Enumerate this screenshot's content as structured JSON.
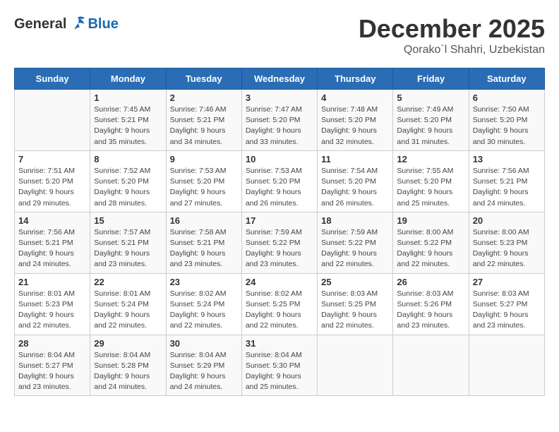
{
  "header": {
    "logo_general": "General",
    "logo_blue": "Blue",
    "month_title": "December 2025",
    "location": "Qorako`l Shahri, Uzbekistan"
  },
  "days_of_week": [
    "Sunday",
    "Monday",
    "Tuesday",
    "Wednesday",
    "Thursday",
    "Friday",
    "Saturday"
  ],
  "weeks": [
    [
      {
        "day": "",
        "info": ""
      },
      {
        "day": "1",
        "info": "Sunrise: 7:45 AM\nSunset: 5:21 PM\nDaylight: 9 hours\nand 35 minutes."
      },
      {
        "day": "2",
        "info": "Sunrise: 7:46 AM\nSunset: 5:21 PM\nDaylight: 9 hours\nand 34 minutes."
      },
      {
        "day": "3",
        "info": "Sunrise: 7:47 AM\nSunset: 5:20 PM\nDaylight: 9 hours\nand 33 minutes."
      },
      {
        "day": "4",
        "info": "Sunrise: 7:48 AM\nSunset: 5:20 PM\nDaylight: 9 hours\nand 32 minutes."
      },
      {
        "day": "5",
        "info": "Sunrise: 7:49 AM\nSunset: 5:20 PM\nDaylight: 9 hours\nand 31 minutes."
      },
      {
        "day": "6",
        "info": "Sunrise: 7:50 AM\nSunset: 5:20 PM\nDaylight: 9 hours\nand 30 minutes."
      }
    ],
    [
      {
        "day": "7",
        "info": "Sunrise: 7:51 AM\nSunset: 5:20 PM\nDaylight: 9 hours\nand 29 minutes."
      },
      {
        "day": "8",
        "info": "Sunrise: 7:52 AM\nSunset: 5:20 PM\nDaylight: 9 hours\nand 28 minutes."
      },
      {
        "day": "9",
        "info": "Sunrise: 7:53 AM\nSunset: 5:20 PM\nDaylight: 9 hours\nand 27 minutes."
      },
      {
        "day": "10",
        "info": "Sunrise: 7:53 AM\nSunset: 5:20 PM\nDaylight: 9 hours\nand 26 minutes."
      },
      {
        "day": "11",
        "info": "Sunrise: 7:54 AM\nSunset: 5:20 PM\nDaylight: 9 hours\nand 26 minutes."
      },
      {
        "day": "12",
        "info": "Sunrise: 7:55 AM\nSunset: 5:20 PM\nDaylight: 9 hours\nand 25 minutes."
      },
      {
        "day": "13",
        "info": "Sunrise: 7:56 AM\nSunset: 5:21 PM\nDaylight: 9 hours\nand 24 minutes."
      }
    ],
    [
      {
        "day": "14",
        "info": "Sunrise: 7:56 AM\nSunset: 5:21 PM\nDaylight: 9 hours\nand 24 minutes."
      },
      {
        "day": "15",
        "info": "Sunrise: 7:57 AM\nSunset: 5:21 PM\nDaylight: 9 hours\nand 23 minutes."
      },
      {
        "day": "16",
        "info": "Sunrise: 7:58 AM\nSunset: 5:21 PM\nDaylight: 9 hours\nand 23 minutes."
      },
      {
        "day": "17",
        "info": "Sunrise: 7:59 AM\nSunset: 5:22 PM\nDaylight: 9 hours\nand 23 minutes."
      },
      {
        "day": "18",
        "info": "Sunrise: 7:59 AM\nSunset: 5:22 PM\nDaylight: 9 hours\nand 22 minutes."
      },
      {
        "day": "19",
        "info": "Sunrise: 8:00 AM\nSunset: 5:22 PM\nDaylight: 9 hours\nand 22 minutes."
      },
      {
        "day": "20",
        "info": "Sunrise: 8:00 AM\nSunset: 5:23 PM\nDaylight: 9 hours\nand 22 minutes."
      }
    ],
    [
      {
        "day": "21",
        "info": "Sunrise: 8:01 AM\nSunset: 5:23 PM\nDaylight: 9 hours\nand 22 minutes."
      },
      {
        "day": "22",
        "info": "Sunrise: 8:01 AM\nSunset: 5:24 PM\nDaylight: 9 hours\nand 22 minutes."
      },
      {
        "day": "23",
        "info": "Sunrise: 8:02 AM\nSunset: 5:24 PM\nDaylight: 9 hours\nand 22 minutes."
      },
      {
        "day": "24",
        "info": "Sunrise: 8:02 AM\nSunset: 5:25 PM\nDaylight: 9 hours\nand 22 minutes."
      },
      {
        "day": "25",
        "info": "Sunrise: 8:03 AM\nSunset: 5:25 PM\nDaylight: 9 hours\nand 22 minutes."
      },
      {
        "day": "26",
        "info": "Sunrise: 8:03 AM\nSunset: 5:26 PM\nDaylight: 9 hours\nand 23 minutes."
      },
      {
        "day": "27",
        "info": "Sunrise: 8:03 AM\nSunset: 5:27 PM\nDaylight: 9 hours\nand 23 minutes."
      }
    ],
    [
      {
        "day": "28",
        "info": "Sunrise: 8:04 AM\nSunset: 5:27 PM\nDaylight: 9 hours\nand 23 minutes."
      },
      {
        "day": "29",
        "info": "Sunrise: 8:04 AM\nSunset: 5:28 PM\nDaylight: 9 hours\nand 24 minutes."
      },
      {
        "day": "30",
        "info": "Sunrise: 8:04 AM\nSunset: 5:29 PM\nDaylight: 9 hours\nand 24 minutes."
      },
      {
        "day": "31",
        "info": "Sunrise: 8:04 AM\nSunset: 5:30 PM\nDaylight: 9 hours\nand 25 minutes."
      },
      {
        "day": "",
        "info": ""
      },
      {
        "day": "",
        "info": ""
      },
      {
        "day": "",
        "info": ""
      }
    ]
  ]
}
